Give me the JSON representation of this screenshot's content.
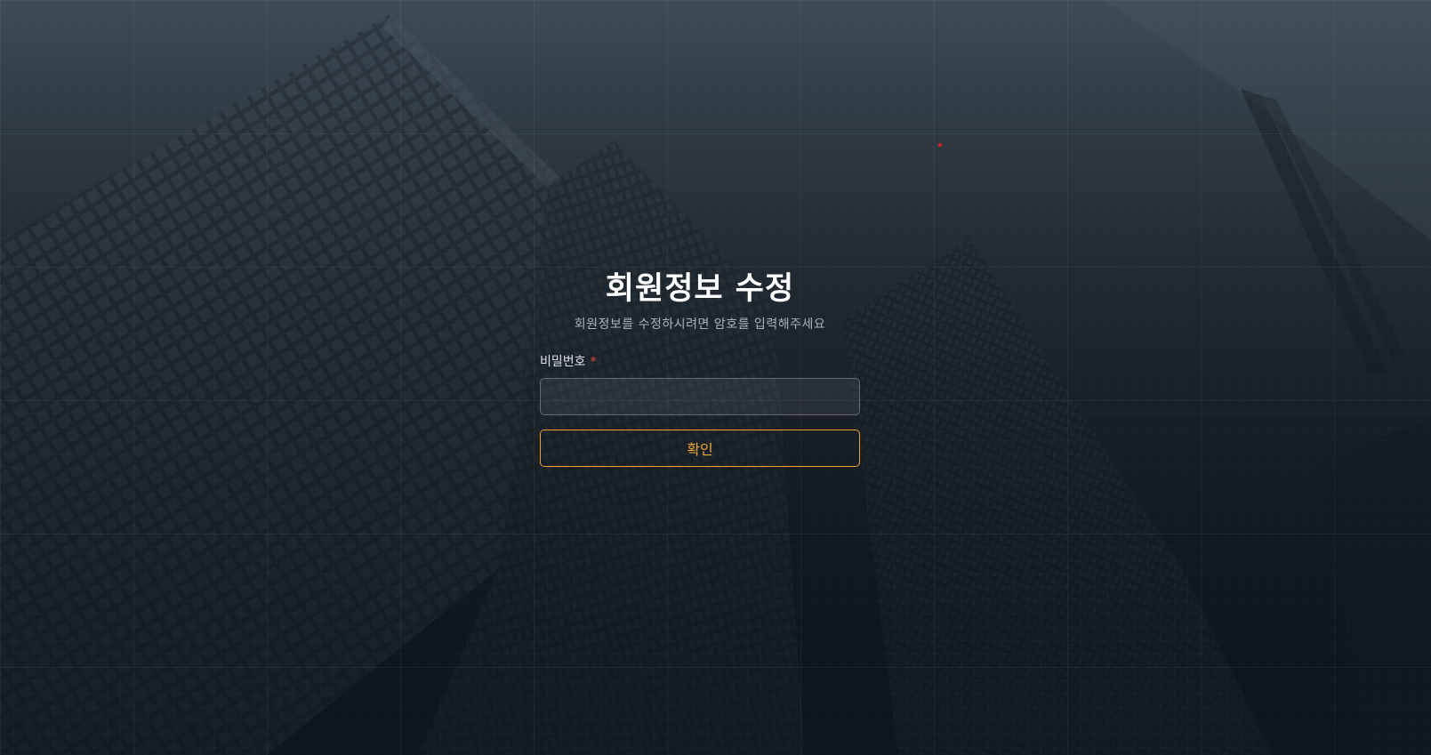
{
  "page": {
    "title": "회원정보 수정",
    "subtitle": "회원정보를 수정하시려면 암호를 입력해주세요"
  },
  "form": {
    "password_label": "비밀번호",
    "required_mark": "*",
    "password_value": "",
    "password_placeholder": "",
    "confirm_label": "확인"
  },
  "colors": {
    "accent": "#f0a531",
    "required": "#e0453a",
    "background_top": "#3e4c56",
    "background_bottom": "#121922"
  }
}
